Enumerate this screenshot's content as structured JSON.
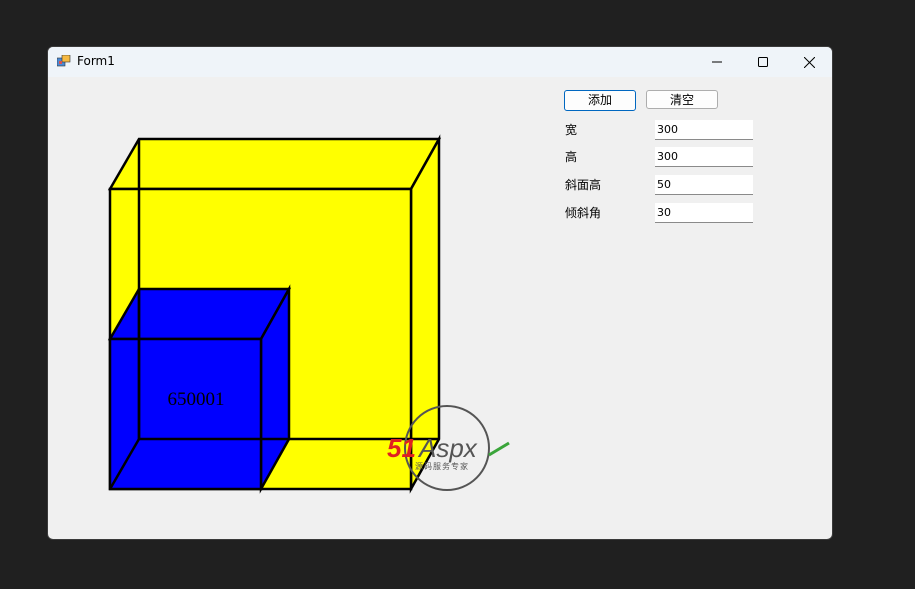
{
  "window": {
    "title": "Form1"
  },
  "controls": {
    "add_button": "添加",
    "clear_button": "清空",
    "fields": [
      {
        "label": "宽",
        "value": "300"
      },
      {
        "label": "高",
        "value": "300"
      },
      {
        "label": "斜面高",
        "value": "50"
      },
      {
        "label": "倾斜角",
        "value": "30"
      }
    ]
  },
  "drawing": {
    "box_label": "650001",
    "colors": {
      "large_box": "#ffff00",
      "small_box": "#0000ff",
      "outline": "#000000"
    }
  },
  "watermark": {
    "brand_a": "51",
    "brand_b": "Aspx",
    "tagline": "源码服务专家"
  }
}
